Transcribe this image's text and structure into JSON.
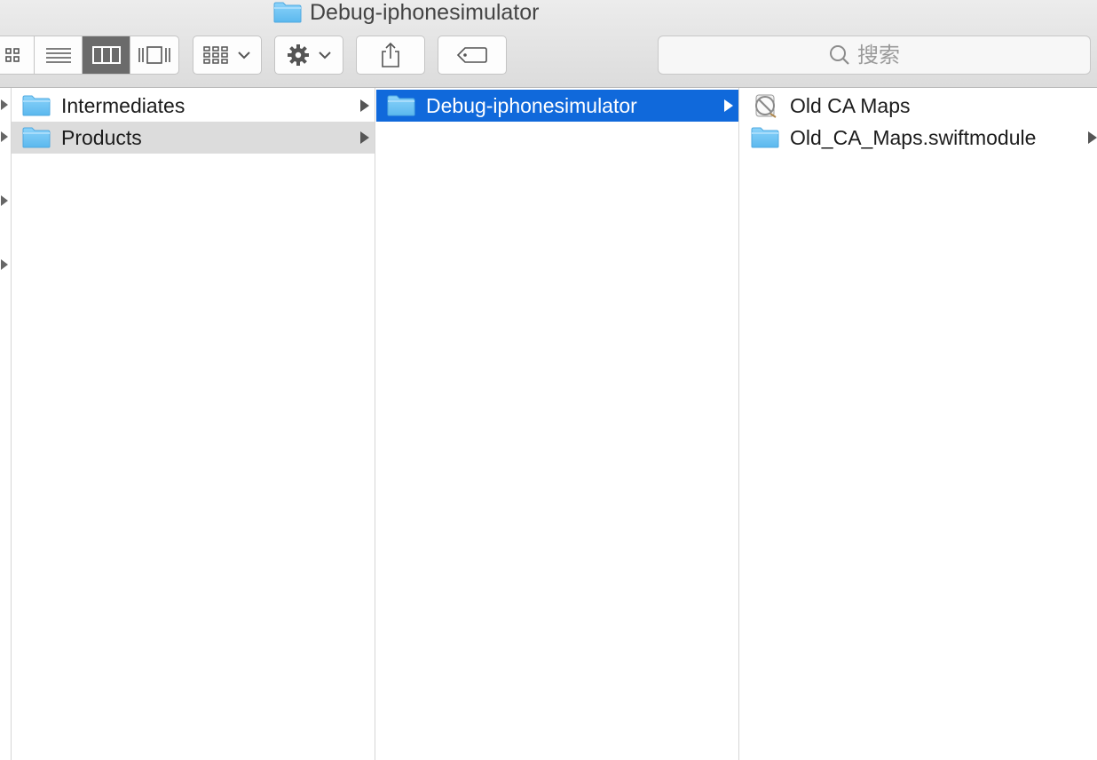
{
  "window": {
    "title": "Debug-iphonesimulator"
  },
  "toolbar": {
    "view_modes": [
      "icon-view",
      "list-view",
      "column-view",
      "cover-flow-view"
    ],
    "active_view": "column-view",
    "search_placeholder": "搜索"
  },
  "columns": [
    {
      "items": [
        {
          "name": "Intermediates",
          "kind": "folder",
          "has_children": true
        },
        {
          "name": "Products",
          "kind": "folder",
          "has_children": true,
          "state": "path"
        }
      ]
    },
    {
      "items": [
        {
          "name": "Debug-iphonesimulator",
          "kind": "folder",
          "has_children": true,
          "state": "selected"
        }
      ]
    },
    {
      "items": [
        {
          "name": "Old CA Maps",
          "kind": "app",
          "has_children": false
        },
        {
          "name": "Old_CA_Maps.swiftmodule",
          "kind": "folder",
          "has_children": true
        }
      ]
    }
  ],
  "colors": {
    "selection": "#1069db",
    "path_highlight": "#dcdcdc",
    "folder": "#6cc3f5"
  }
}
